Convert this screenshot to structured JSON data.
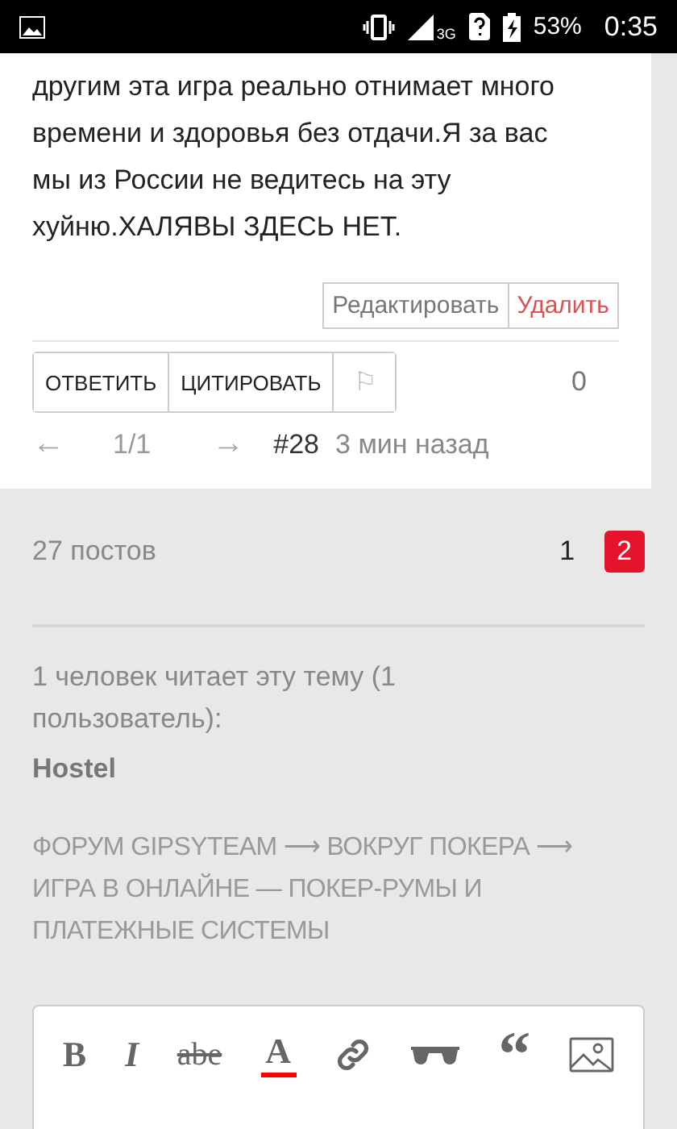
{
  "status_bar": {
    "signal": "3G",
    "battery": "53%",
    "time": "0:35"
  },
  "post": {
    "text": "другим эта игра реально отнимает много времени и здоровья без отдачи.Я за вас мы из России не ведитесь на эту хуйню.ХАЛЯВЫ ЗДЕСЬ НЕТ.",
    "edit_actions": [
      {
        "label": "Редактировать",
        "kind": "normal"
      },
      {
        "label": "Удалить",
        "kind": "danger"
      }
    ],
    "actions": [
      {
        "label": "ОТВЕТИТЬ",
        "kind": "text"
      },
      {
        "label": "ЦИТИРОВАТЬ",
        "kind": "text"
      },
      {
        "label": "⚐",
        "kind": "flag"
      }
    ],
    "likes": "0",
    "nav": {
      "prev": "←",
      "page": "1/1",
      "next": "→"
    },
    "number": "#28",
    "time": "3 мин назад"
  },
  "topic": {
    "posts": "27 постов",
    "pages": [
      {
        "label": "1",
        "selected": false
      },
      {
        "label": "2",
        "selected": true
      }
    ],
    "readers": "1 человек читает эту тему (1 пользователь):",
    "users": [
      "Hostel"
    ],
    "breadcrumbs": [
      "ФОРУМ GIPSYTEAM",
      "ВОКРУГ ПОКЕРА",
      "ИГРА В ОНЛАЙНЕ — ПОКЕР-РУМЫ И ПЛАТЕЖНЫЕ СИСТЕМЫ"
    ],
    "separator": "⟶"
  },
  "editor": {
    "tools": [
      {
        "kind": "bold",
        "label": "B"
      },
      {
        "kind": "italic",
        "label": "I"
      },
      {
        "kind": "strike",
        "label": "abe"
      },
      {
        "kind": "color",
        "label": "A",
        "color": "#ff0000"
      },
      {
        "kind": "link"
      },
      {
        "kind": "glasses"
      },
      {
        "kind": "quote",
        "label": "“"
      },
      {
        "kind": "image"
      }
    ]
  }
}
